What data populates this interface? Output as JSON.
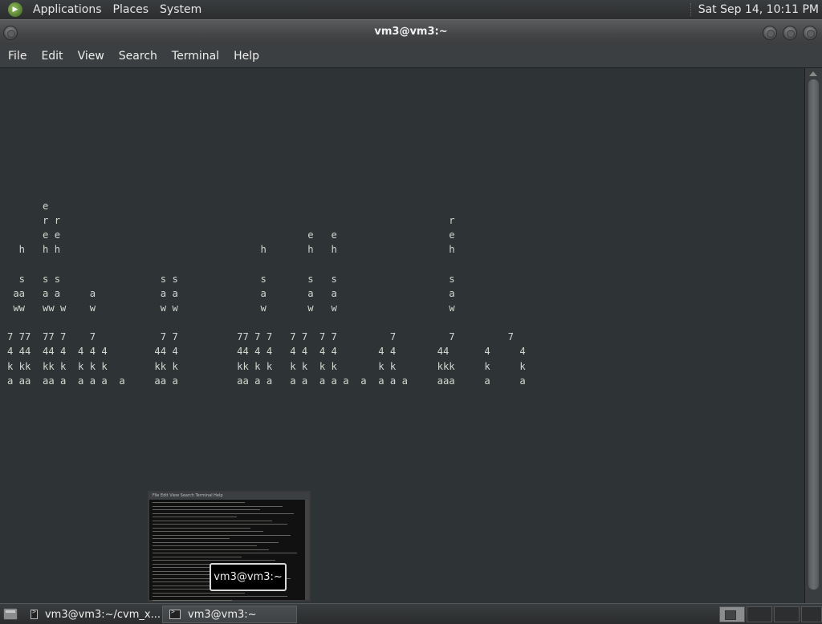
{
  "top_panel": {
    "menus": [
      "Applications",
      "Places",
      "System"
    ],
    "clock": "Sat Sep 14, 10:11 PM"
  },
  "window": {
    "title": "vm3@vm3:~"
  },
  "menubar": {
    "items": [
      "File",
      "Edit",
      "View",
      "Search",
      "Terminal",
      "Help"
    ]
  },
  "terminal": {
    "lines": [
      "",
      "",
      "",
      "",
      "",
      "      e",
      "      r r                                                                  r",
      "      e e                                          e   e                   e",
      "  h   h h                                  h       h   h                   h",
      "",
      "  s   s s                 s s              s       s   s                   s",
      " aa   a a     a           a a              a       a   a                   a",
      " ww   ww w    w           w w              w       w   w                   w",
      "",
      "7 77  77 7    7           7 7          77 7 7   7 7  7 7         7         7         7",
      "4 44  44 4  4 4 4        44 4          44 4 4   4 4  4 4       4 4       44      4     4",
      "k kk  kk k  k k k        kk k          kk k k   k k  k k       k k       kkk     k     k",
      "a aa  aa a  a a a  a     aa a          aa a a   a a  a a a  a  a a a     aaa     a     a"
    ]
  },
  "switcher": {
    "label": "vm3@vm3:~",
    "preview_menu": "File  Edit  View  Search  Terminal  Help"
  },
  "taskbar": {
    "tasks": [
      {
        "label": "vm3@vm3:~/cvm_x..."
      },
      {
        "label": "vm3@vm3:~"
      }
    ]
  }
}
